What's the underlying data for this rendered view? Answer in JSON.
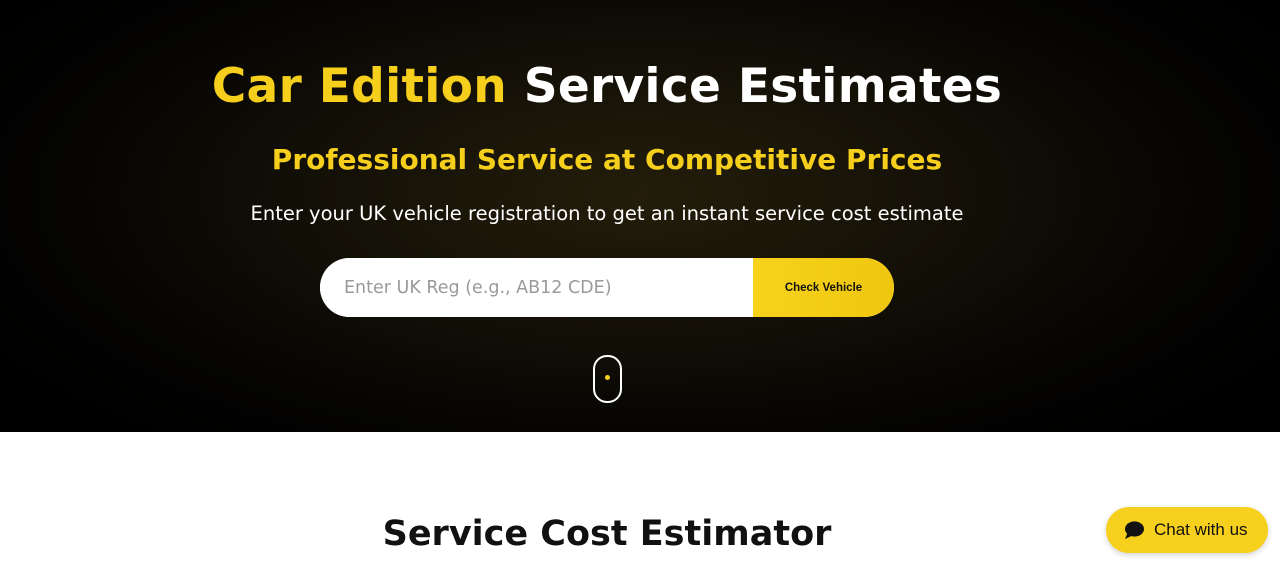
{
  "hero": {
    "title_accent": "Car Edition",
    "title_rest": "Service Estimates",
    "subtitle": "Professional Service at Competitive Prices",
    "description": "Enter your UK vehicle registration to get an instant service cost estimate"
  },
  "registration_form": {
    "input_placeholder": "Enter UK Reg (e.g., AB12 CDE)",
    "input_value": "",
    "button_label": "Check Vehicle"
  },
  "scroll_indicator": {
    "icon": "mouse-scroll-icon"
  },
  "estimator_section": {
    "title": "Service Cost Estimator"
  },
  "chat_widget": {
    "label": "Chat with us",
    "icon": "chat-bubble-icon"
  },
  "colors": {
    "accent": "#f6cf1c",
    "hero_background": "#000000",
    "button": "#f7d21c",
    "text_dark": "#111111"
  }
}
